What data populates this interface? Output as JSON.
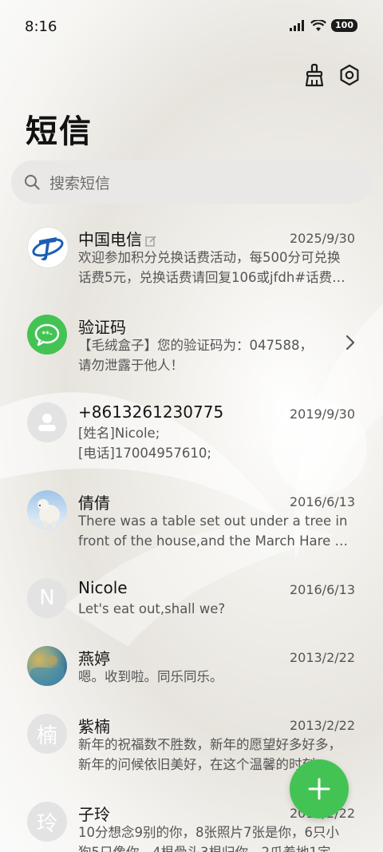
{
  "status_bar": {
    "time": "8:16",
    "battery": "100"
  },
  "header": {
    "title": "短信"
  },
  "search": {
    "placeholder": "搜索短信"
  },
  "messages": [
    {
      "name": "中国电信",
      "date": "2025/9/30",
      "lines": [
        "欢迎参加积分兑换话费活动，每500分可兑换",
        "话费5元，兑换话费请回复106或jfdh#话费…"
      ]
    },
    {
      "name": "验证码",
      "date": "",
      "lines": [
        "【毛绒盒子】您的验证码为：047588，",
        "请勿泄露于他人！"
      ]
    },
    {
      "name": "+8613261230775",
      "date": "2019/9/30",
      "lines": [
        "[姓名]Nicole;",
        "[电话]17004957610;"
      ]
    },
    {
      "name": "倩倩",
      "date": "2016/6/13",
      "lines": [
        "There was a table set out under a tree in",
        "front of the house,and the March Hare an…"
      ]
    },
    {
      "name": "Nicole",
      "date": "2016/6/13",
      "avatar_letter": "N",
      "lines": [
        "Let's eat out,shall we?"
      ]
    },
    {
      "name": "燕婷",
      "date": "2013/2/22",
      "lines": [
        "嗯。收到啦。同乐同乐。"
      ]
    },
    {
      "name": "紫楠",
      "date": "2013/2/22",
      "avatar_letter": "楠",
      "lines": [
        "新年的祝福数不胜数，新年的愿望好多好多，",
        "新年的问候依旧美好，在这个温馨的时刻…"
      ]
    },
    {
      "name": "子玲",
      "date": "2013/2/22",
      "avatar_letter": "玲",
      "lines": [
        "10分想念9别的你，8张照片7张是你，6只小",
        "狗5只像你，4根骨头3根归你，2爪着地1定…"
      ]
    }
  ],
  "colors": {
    "accent": "#44c355",
    "telecom_blue": "#1a5fb4"
  },
  "icons": {
    "clean": "broom-icon",
    "settings": "settings-icon",
    "search": "search-icon",
    "compose": "plus-icon"
  }
}
